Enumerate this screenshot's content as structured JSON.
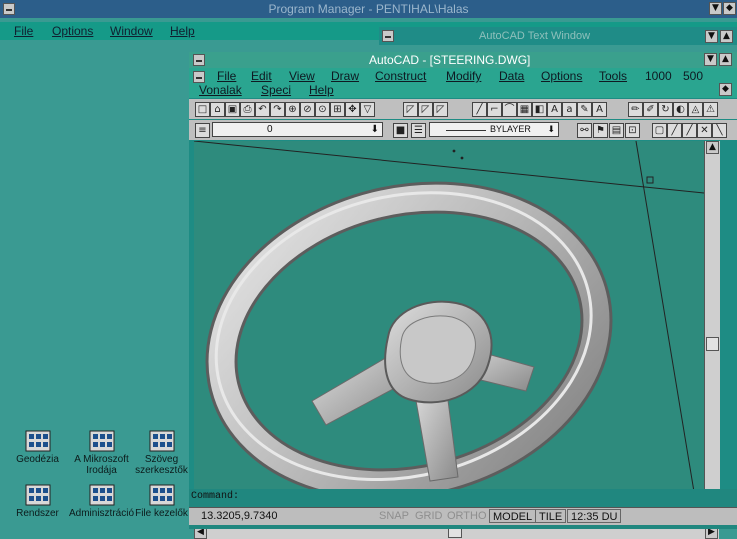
{
  "program_manager": {
    "title": "Program Manager - PENTIHAL\\Halas",
    "menu": [
      {
        "label": "File"
      },
      {
        "label": "Options"
      },
      {
        "label": "Window"
      },
      {
        "label": "Help"
      }
    ]
  },
  "text_window": {
    "title": "AutoCAD Text Window"
  },
  "autocad": {
    "title": "AutoCAD - [STEERING.DWG]",
    "menu_row1": [
      "File",
      "Edit",
      "View",
      "Draw",
      "Construct",
      "Modify",
      "Data",
      "Options",
      "Tools",
      "1000",
      "500"
    ],
    "menu_row2": [
      "Vonalak",
      "Speci",
      "Help"
    ],
    "layer_value": "0",
    "linetype_value": "BYLAYER",
    "command_prompt": "Command:",
    "status": {
      "coords": "13.3205,9.7340",
      "snap": "SNAP",
      "grid": "GRID",
      "ortho": "ORTHO",
      "model": "MODEL",
      "tile": "TILE",
      "time": "12:35 DU"
    }
  },
  "desktop_icons": [
    {
      "label": "Geodézia",
      "icon": "program-group-icon"
    },
    {
      "label": "A Mikroszoft Irodája",
      "icon": "program-group-icon"
    },
    {
      "label": "Szöveg szerkesztők",
      "icon": "program-group-icon"
    },
    {
      "label": "Rendszer",
      "icon": "program-group-icon"
    },
    {
      "label": "Adminisztráció",
      "icon": "program-group-icon"
    },
    {
      "label": "File kezelők",
      "icon": "program-group-icon"
    }
  ],
  "colors": {
    "desktop": "#3a9a92",
    "pm_titlebar": "#2c5e8a",
    "menu_bar": "#159a88",
    "drawing_bg": "#2e8b7d",
    "toolbar": "#bfbfbf",
    "wheel": "#b9b9b9"
  }
}
